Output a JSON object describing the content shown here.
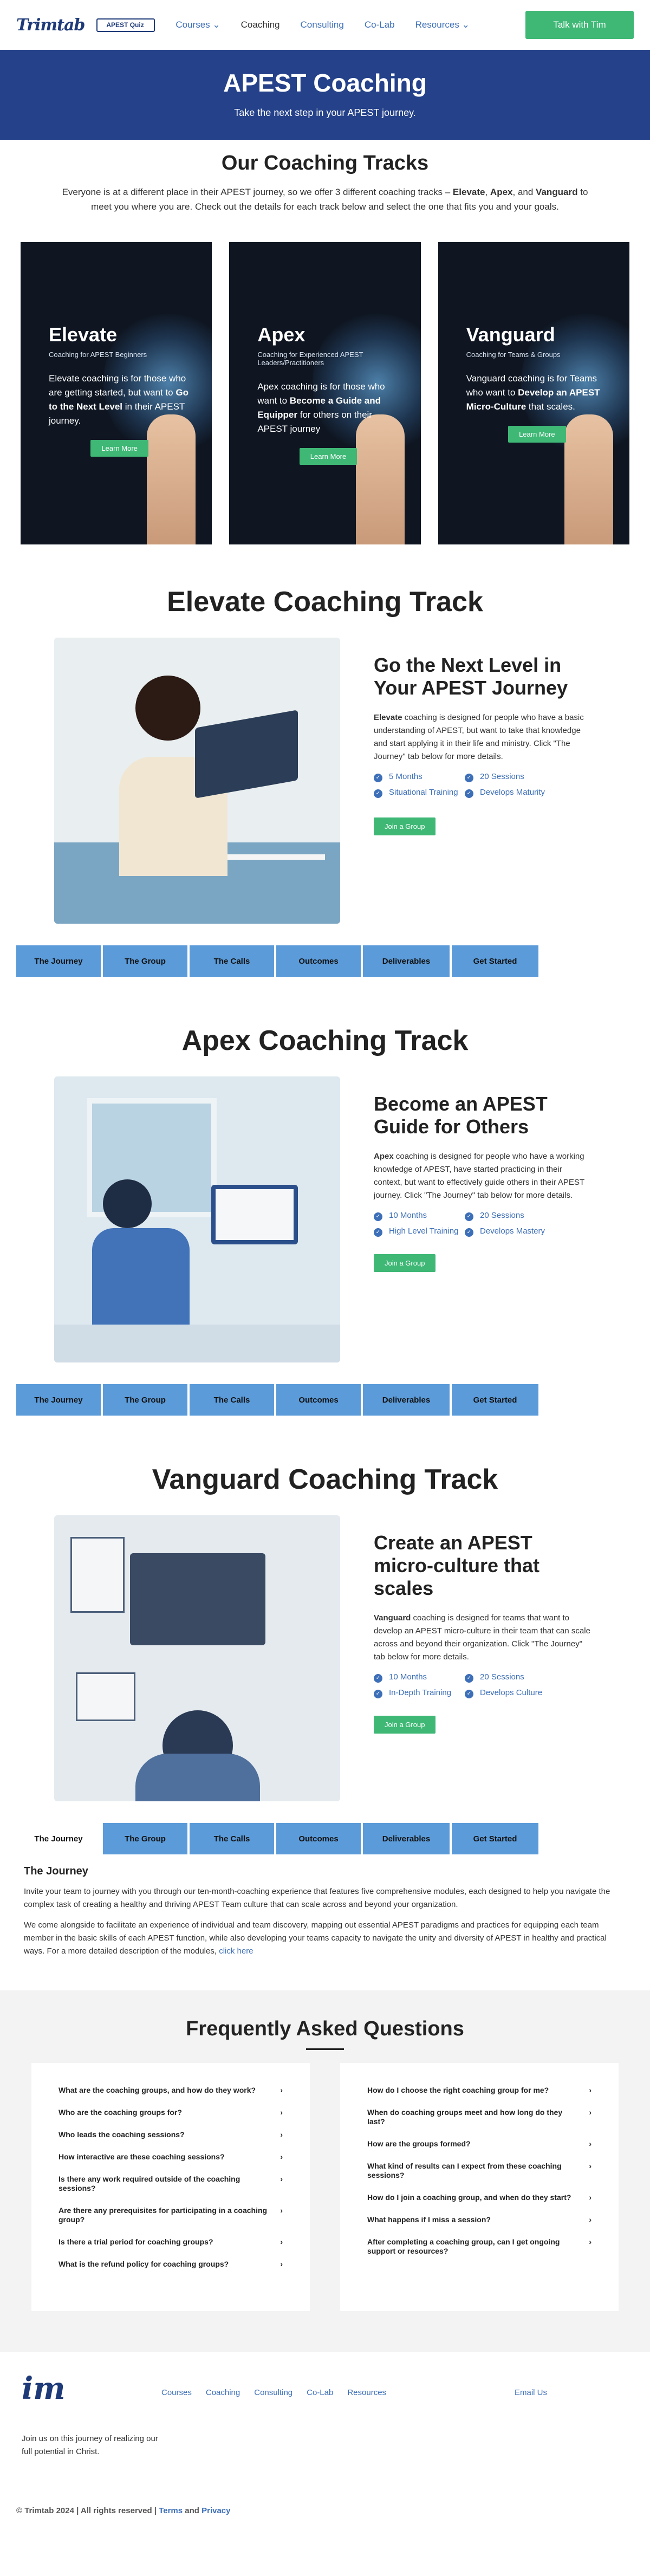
{
  "nav": {
    "logo": "Trimtab",
    "quiz": "APEST Quiz",
    "items": [
      "Courses",
      "Coaching",
      "Consulting",
      "Co-Lab",
      "Resources"
    ],
    "cta": "Talk with Tim"
  },
  "hero": {
    "title": "APEST Coaching",
    "subtitle": "Take the next step in your APEST journey."
  },
  "intro": {
    "title": "Our Coaching Tracks",
    "text_a": "Everyone is at a different place in their APEST journey, so we offer 3 different coaching tracks – ",
    "elevate": "Elevate",
    "sep1": ", ",
    "apex": "Apex",
    "sep2": ", and ",
    "vanguard": "Vanguard",
    "text_b": " to meet you where you are. Check out the details for each track below and select the one that fits you and your goals."
  },
  "tracks": [
    {
      "name": "Elevate",
      "sub": "Coaching for APEST Beginners",
      "desc_a": "Elevate coaching is for those who are getting started, but want to ",
      "desc_b": "Go to the Next Level",
      "desc_c": " in their APEST journey.",
      "btn": "Learn More"
    },
    {
      "name": "Apex",
      "sub": "Coaching for Experienced APEST Leaders/Practitioners",
      "desc_a": "Apex coaching is for those who want to ",
      "desc_b": "Become a Guide and Equipper",
      "desc_c": " for others on their APEST journey",
      "btn": "Learn More"
    },
    {
      "name": "Vanguard",
      "sub": "Coaching for Teams & Groups",
      "desc_a": "Vanguard coaching is for Teams who want to ",
      "desc_b": "Develop an APEST Micro-Culture",
      "desc_c": " that scales.",
      "btn": "Learn More"
    }
  ],
  "elevate": {
    "section": "Elevate Coaching Track",
    "heading": "Go the Next Level in Your APEST Journey",
    "lead": "Elevate",
    "body": " coaching is designed for people who have a basic understanding of APEST, but want to take that knowledge and start applying it in their life and ministry. Click \"The Journey\" tab below for more details.",
    "features": [
      "5 Months",
      "20 Sessions",
      "Situational Training",
      "Develops Maturity"
    ],
    "join": "Join a Group"
  },
  "apex": {
    "section": "Apex Coaching Track",
    "heading": "Become an APEST Guide for Others",
    "lead": "Apex",
    "body": " coaching is designed for people who have a working knowledge of APEST, have started practicing in their context, but want to effectively guide others in their APEST journey. Click \"The Journey\" tab below for more details.",
    "features": [
      "10 Months",
      "20 Sessions",
      "High Level Training",
      "Develops Mastery"
    ],
    "join": "Join a Group"
  },
  "vanguard": {
    "section": "Vanguard Coaching Track",
    "heading": "Create an APEST micro-culture that scales",
    "lead": "Vanguard",
    "body": " coaching is designed for teams that want to develop an APEST micro-culture in their team that can scale across and beyond their organization. Click \"The Journey\" tab below for more details.",
    "features": [
      "10 Months",
      "20 Sessions",
      "In-Depth Training",
      "Develops Culture"
    ],
    "join": "Join a Group"
  },
  "tabs": [
    "The Journey",
    "The Group",
    "The Calls",
    "Outcomes",
    "Deliverables",
    "Get Started"
  ],
  "journey": {
    "title": "The Journey",
    "p1": "Invite your team to journey with you through our ten-month-coaching experience that features five comprehensive modules, each designed to help you navigate the complex task of creating a healthy and thriving APEST Team culture that can scale across and beyond your organization.",
    "p2": "We come alongside to facilitate an experience of individual and team discovery, mapping out essential APEST paradigms and practices for equipping each team member in the basic skills of each APEST function, while also developing your teams capacity to navigate the unity and diversity of APEST in healthy and practical ways. For a more detailed description of the modules, ",
    "link": "click here"
  },
  "faq": {
    "title": "Frequently Asked Questions",
    "left": [
      "What are the coaching groups, and how do they work?",
      "Who are the coaching groups for?",
      "Who leads the coaching sessions?",
      "How interactive are these coaching sessions?",
      "Is there any work required outside of the coaching sessions?",
      "Are there any prerequisites for participating in a coaching group?",
      "Is there a trial period for coaching groups?",
      "What is the refund policy for coaching groups?"
    ],
    "right": [
      "How do I choose the right coaching group for me?",
      "When do coaching groups meet and how long do they last?",
      "How are the groups formed?",
      "What kind of results can I expect from these coaching sessions?",
      "How do I join a coaching group, and when do they start?",
      "What happens if I miss a session?",
      "After completing a coaching group, can I get ongoing support or resources?"
    ]
  },
  "footer": {
    "logo": "im",
    "nav": [
      "Courses",
      "Coaching",
      "Consulting",
      "Co-Lab",
      "Resources"
    ],
    "email": "Email Us",
    "tagline": "Join us on this journey of realizing our full potential in Christ.",
    "copy": "© Trimtab 2024 | All rights reserved | ",
    "terms": "Terms",
    "and": " and ",
    "privacy": "Privacy"
  },
  "colors": {
    "brand": "#244189",
    "accent": "#3fb876",
    "link": "#3d6fb8",
    "tab": "#5b9bd9"
  }
}
